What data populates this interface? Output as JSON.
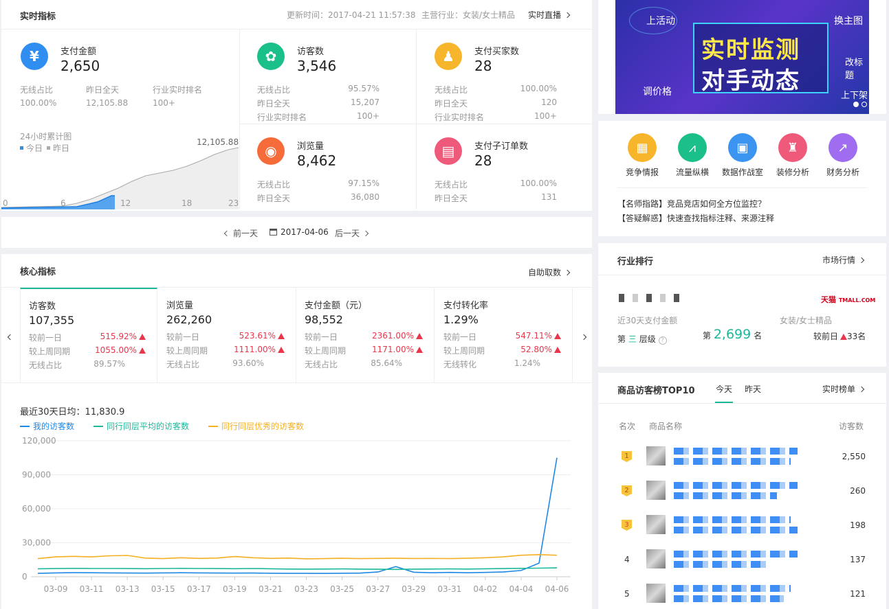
{
  "realtime": {
    "title": "实时指标",
    "update_time": "更新时间：2017-04-21 11:57:38",
    "industry": "主营行业：女装/女士精品",
    "live_link": "实时直播",
    "pay_amount": {
      "label": "支付金额",
      "value": "2,650",
      "cols": [
        {
          "label": "无线占比",
          "value": "100.00%"
        },
        {
          "label": "昨日全天",
          "value": "12,105.88"
        },
        {
          "label": "行业实时排名",
          "value": "100+"
        }
      ]
    },
    "chart_label": "24小时累计图",
    "legend_today": "今日",
    "legend_yesterday": "昨日",
    "peak_label": "12,105.88",
    "x_ticks": [
      "0",
      "6",
      "12",
      "18",
      "23"
    ],
    "visitors": {
      "label": "访客数",
      "value": "3,546",
      "rows": [
        {
          "label": "无线占比",
          "value": "95.57%"
        },
        {
          "label": "昨日全天",
          "value": "15,207"
        },
        {
          "label": "行业实时排名",
          "value": "100+"
        }
      ]
    },
    "buyers": {
      "label": "支付买家数",
      "value": "28",
      "rows": [
        {
          "label": "无线占比",
          "value": "100.00%"
        },
        {
          "label": "昨日全天",
          "value": "120"
        },
        {
          "label": "行业实时排名",
          "value": "100+"
        }
      ]
    },
    "pageviews": {
      "label": "浏览量",
      "value": "8,462",
      "rows": [
        {
          "label": "无线占比",
          "value": "97.15%"
        },
        {
          "label": "昨日全天",
          "value": "36,080"
        }
      ]
    },
    "suborders": {
      "label": "支付子订单数",
      "value": "28",
      "rows": [
        {
          "label": "无线占比",
          "value": "100.00%"
        },
        {
          "label": "昨日全天",
          "value": "131"
        }
      ]
    }
  },
  "datebar": {
    "prev": "前一天",
    "date": "2017-04-06",
    "next": "后一天"
  },
  "core": {
    "title": "核心指标",
    "self_fetch": "自助取数",
    "cards": [
      {
        "label": "访客数",
        "value": "107,355",
        "r1l": "较前一日",
        "r1v": "515.92%",
        "r2l": "较上周同期",
        "r2v": "1055.00%",
        "r3l": "无线占比",
        "r3v": "89.57%"
      },
      {
        "label": "浏览量",
        "value": "262,260",
        "r1l": "较前一日",
        "r1v": "523.61%",
        "r2l": "较上周同期",
        "r2v": "1111.00%",
        "r3l": "无线占比",
        "r3v": "93.60%"
      },
      {
        "label": "支付金额（元）",
        "value": "98,552",
        "r1l": "较前一日",
        "r1v": "2361.00%",
        "r2l": "较上周同期",
        "r2v": "1171.00%",
        "r3l": "无线占比",
        "r3v": "85.64%"
      },
      {
        "label": "支付转化率",
        "value": "1.29%",
        "r1l": "较前一日",
        "r1v": "547.11%",
        "r2l": "较上周同期",
        "r2v": "52.80%",
        "r3l": "无线转化",
        "r3v": "1.24%"
      }
    ],
    "avg_label": "最近30天日均：11,830.9",
    "legend": [
      "我的访客数",
      "同行同层平均的访客数",
      "同行同层优秀的访客数"
    ]
  },
  "chart_data": {
    "type": "line",
    "xlabel": "",
    "ylabel": "",
    "ylim": [
      0,
      120000
    ],
    "y_ticks": [
      "0",
      "30,000",
      "60,000",
      "90,000",
      "120,000"
    ],
    "x_ticks": [
      "03-09",
      "03-11",
      "03-13",
      "03-15",
      "03-17",
      "03-19",
      "03-21",
      "03-23",
      "03-25",
      "03-27",
      "03-29",
      "03-31",
      "04-02",
      "04-04",
      "04-06"
    ],
    "x": [
      "03-08",
      "03-09",
      "03-10",
      "03-11",
      "03-12",
      "03-13",
      "03-14",
      "03-15",
      "03-16",
      "03-17",
      "03-18",
      "03-19",
      "03-20",
      "03-21",
      "03-22",
      "03-23",
      "03-24",
      "03-25",
      "03-26",
      "03-27",
      "03-28",
      "03-29",
      "03-30",
      "03-31",
      "04-01",
      "04-02",
      "04-03",
      "04-04",
      "04-05",
      "04-06"
    ],
    "series": [
      {
        "name": "我的访客数",
        "color": "#1e88e5",
        "values": [
          3000,
          3400,
          3600,
          3500,
          3400,
          3300,
          3200,
          3400,
          3500,
          3400,
          3300,
          3200,
          3300,
          3100,
          3000,
          3000,
          2900,
          3100,
          3200,
          4200,
          9000,
          4000,
          3500,
          3800,
          3500,
          3800,
          4200,
          5500,
          12000,
          105000
        ]
      },
      {
        "name": "同行同层平均的访客数",
        "color": "#1bb89a",
        "values": [
          7000,
          7200,
          7400,
          7300,
          7300,
          7200,
          7100,
          7300,
          7400,
          7300,
          7200,
          7100,
          7300,
          7000,
          6800,
          6700,
          6800,
          6900,
          6700,
          6600,
          6500,
          6700,
          6800,
          6900,
          6800,
          7000,
          7200,
          7400,
          7600,
          7800
        ]
      },
      {
        "name": "同行同层优秀的访客数",
        "color": "#f5b023",
        "values": [
          16000,
          17500,
          18000,
          17500,
          18500,
          18800,
          16500,
          16000,
          16800,
          16200,
          16500,
          17800,
          16800,
          16200,
          16500,
          15800,
          16000,
          16300,
          16000,
          16200,
          16300,
          16100,
          16200,
          16000,
          16300,
          16800,
          17500,
          19000,
          19500,
          19000
        ]
      }
    ]
  },
  "right": {
    "banner_main1": "实时监测",
    "banner_main2": "对手动态",
    "banner_tags": [
      "上活动",
      "换主图",
      "改标题",
      "调价格",
      "上下架"
    ],
    "tools": [
      "竞争情报",
      "流量纵横",
      "数据作战室",
      "装修分析",
      "财务分析"
    ],
    "tips": [
      "【名师指路】竞品竞店如何全方位监控？",
      "【答疑解惑】快速查找指标注释、来源注释"
    ],
    "ranking": {
      "title": "行业排行",
      "market_link": "市场行情",
      "brand": "天猫",
      "brand_domain": "TMALL.COM",
      "desc": "近30天支付金额",
      "industry": "女装/女士精品",
      "tier_prefix": "第",
      "tier_num": "三",
      "tier_suffix": "层级",
      "rank_prefix": "第",
      "rank_num": "2,699",
      "rank_suffix": "名",
      "prev_day": "较前日",
      "prev_change": "33名"
    },
    "top10": {
      "title": "商品访客榜TOP10",
      "tab_today": "今天",
      "tab_yesterday": "昨天",
      "realtime_link": "实时榜单",
      "col_rank": "名次",
      "col_name": "商品名称",
      "col_visitors": "访客数",
      "rows": [
        {
          "rank": "1",
          "visitors": "2,550"
        },
        {
          "rank": "2",
          "visitors": "260"
        },
        {
          "rank": "3",
          "visitors": "198"
        },
        {
          "rank": "4",
          "visitors": "137"
        },
        {
          "rank": "5",
          "visitors": "121"
        }
      ]
    }
  }
}
